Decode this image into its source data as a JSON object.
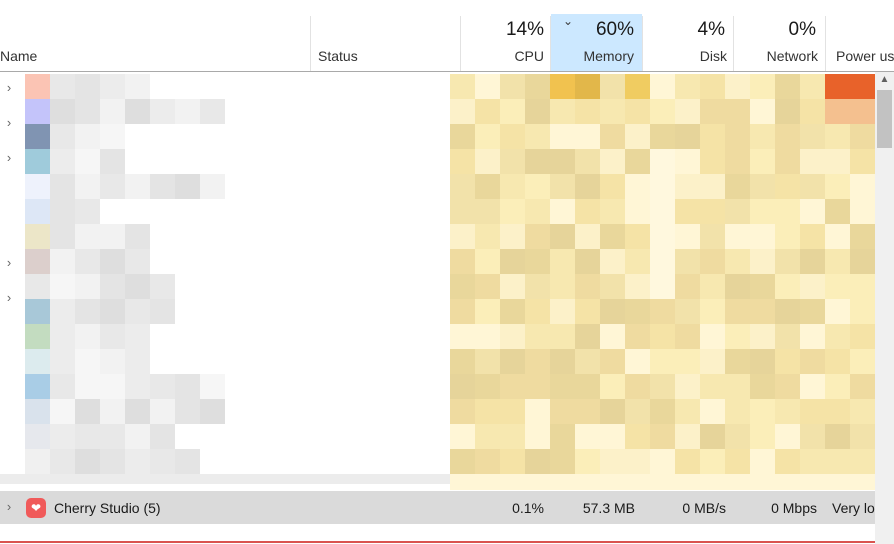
{
  "columns": {
    "name": "Name",
    "status": "Status",
    "cpu": {
      "percent": "14%",
      "label": "CPU"
    },
    "memory": {
      "percent": "60%",
      "label": "Memory",
      "sorted": true
    },
    "disk": {
      "percent": "4%",
      "label": "Disk"
    },
    "network": {
      "percent": "0%",
      "label": "Network"
    },
    "power": {
      "label": "Power us"
    }
  },
  "icons": {
    "sort": "chevron-down-icon",
    "expand": "chevron-right-icon",
    "app": "cherry-studio-icon",
    "scroll_up": "arrow-up-icon"
  },
  "colors": {
    "memory_header": "#cce8ff",
    "selected_row": "#dadada",
    "heat_light": "#fff4d1",
    "heat_dark": "#f0c24f",
    "power_high": "#e8622a",
    "accent_line": "#d9534f"
  },
  "selected_process": {
    "name": "Cherry Studio (5)",
    "cpu": "0.1%",
    "memory": "57.3 MB",
    "disk": "0 MB/s",
    "network": "0 Mbps",
    "power": "Very lo"
  }
}
